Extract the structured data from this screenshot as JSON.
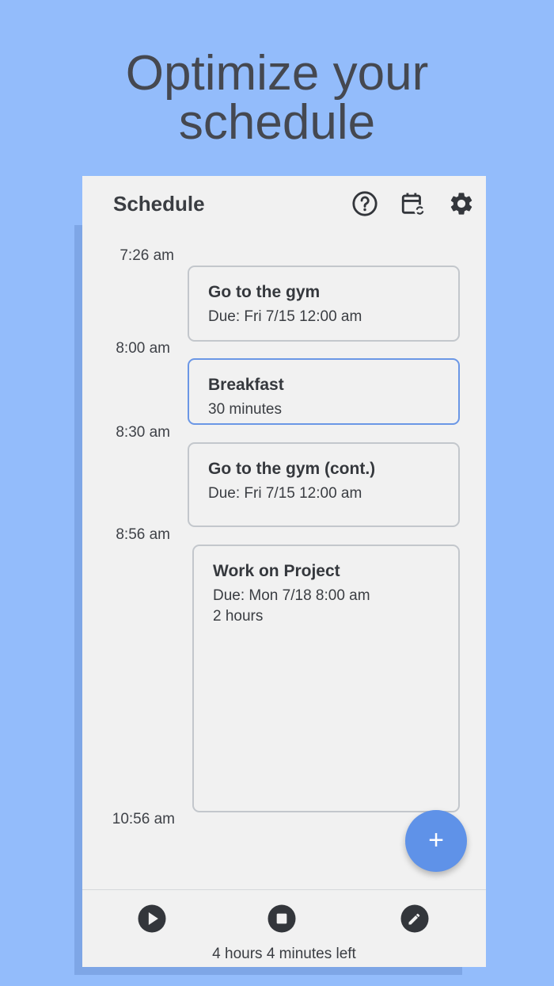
{
  "promo": {
    "headline_line1": "Optimize your",
    "headline_line2": "schedule"
  },
  "appbar": {
    "title": "Schedule",
    "icons": [
      "help-icon",
      "calendar-sync-icon",
      "gear-icon"
    ]
  },
  "timeline": {
    "times": [
      "7:26 am",
      "8:00 am",
      "8:30 am",
      "8:56 am",
      "10:56 am"
    ]
  },
  "tasks": [
    {
      "title": "Go to the gym",
      "line1": "Due: Fri 7/15 12:00 am",
      "line2": "",
      "active": false
    },
    {
      "title": "Breakfast",
      "line1": "30 minutes",
      "line2": "",
      "active": true
    },
    {
      "title": "Go to the gym (cont.)",
      "line1": "Due: Fri 7/15 12:00 am",
      "line2": "",
      "active": false
    },
    {
      "title": "Work on Project",
      "line1": "Due: Mon 7/18  8:00 am",
      "line2": "2 hours",
      "active": false
    }
  ],
  "fab": {
    "label": "+"
  },
  "bottombar": {
    "icons": [
      "play-icon",
      "stop-icon",
      "edit-icon"
    ],
    "remaining": "4 hours 4 minutes left"
  },
  "colors": {
    "background": "#93BCFB",
    "active_border": "#6b97e6",
    "fab": "#5f92e8"
  }
}
